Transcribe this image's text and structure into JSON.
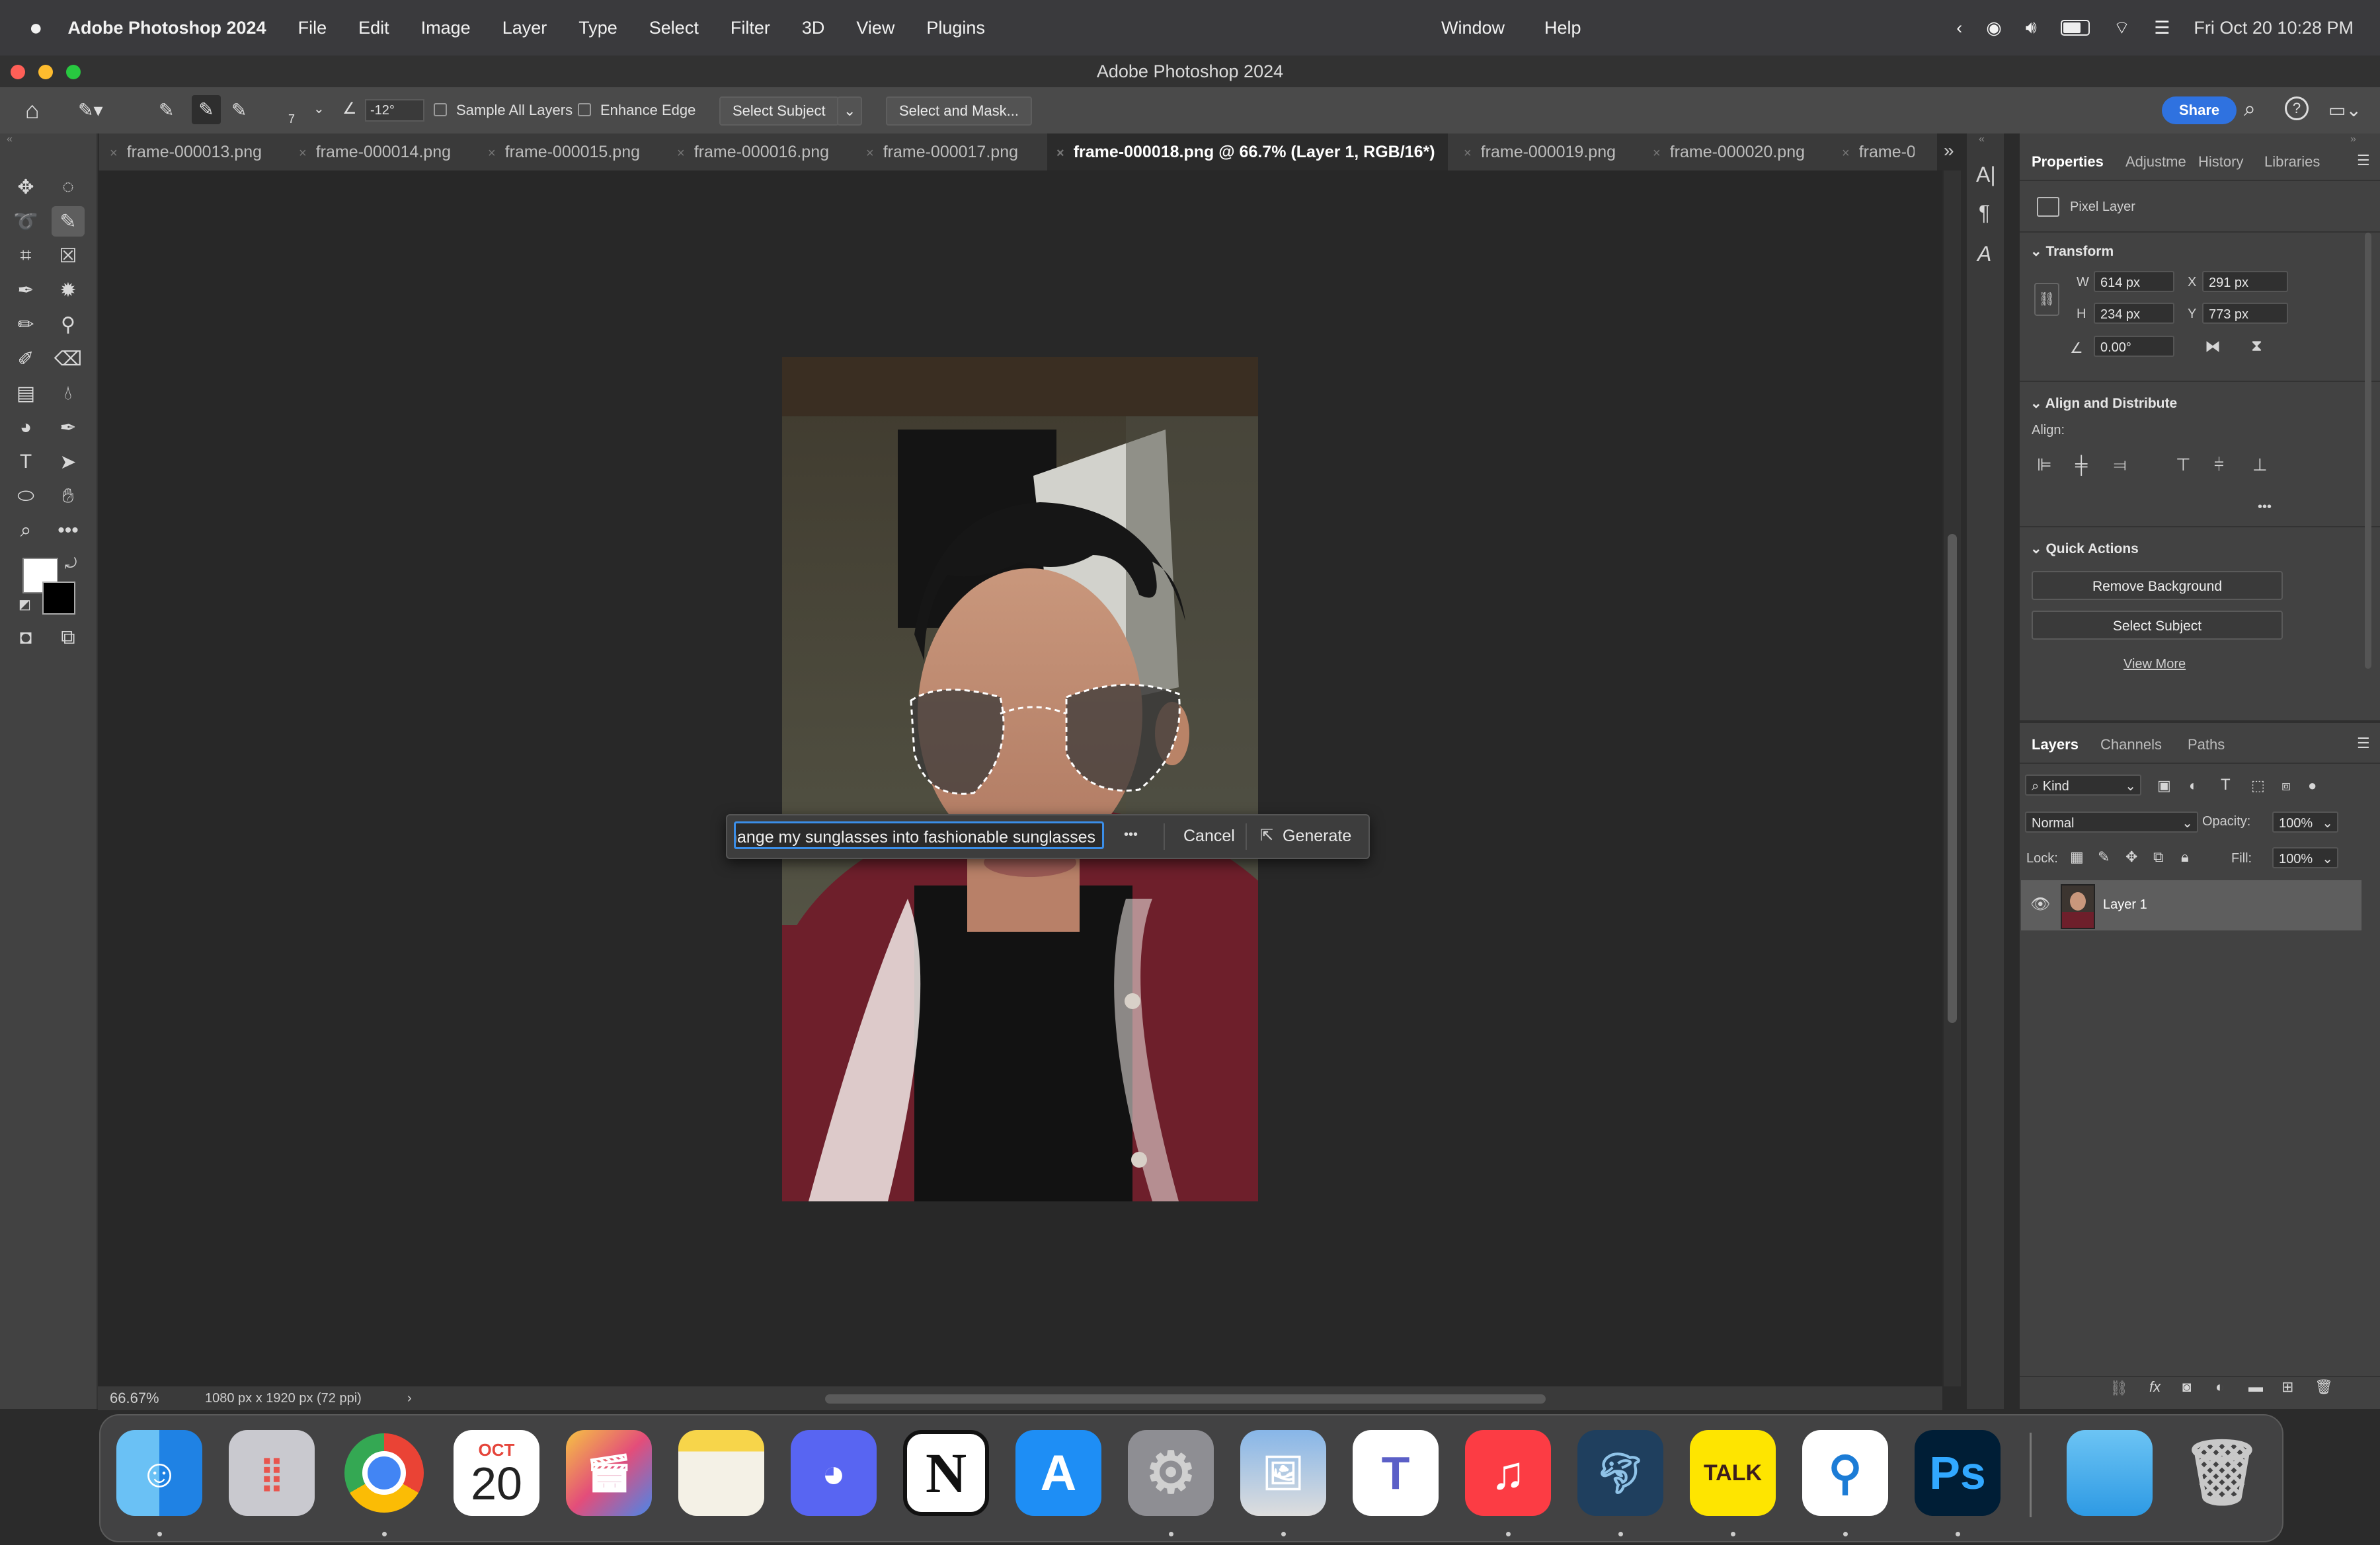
{
  "menubar": {
    "app_name": "Adobe Photoshop 2024",
    "items": [
      "File",
      "Edit",
      "Image",
      "Layer",
      "Type",
      "Select",
      "Filter",
      "3D",
      "View",
      "Plugins"
    ],
    "center_items": [
      "Window",
      "Help"
    ],
    "datetime": "Fri Oct 20  10:28 PM"
  },
  "window": {
    "title": "Adobe Photoshop 2024"
  },
  "options": {
    "brush_size": "7",
    "angle": "-12°",
    "sample_all_layers": "Sample All Layers",
    "enhance_edge": "Enhance Edge",
    "select_subject": "Select Subject",
    "select_and_mask": "Select and Mask...",
    "share": "Share"
  },
  "tabs": [
    "frame-000013.png",
    "frame-000014.png",
    "frame-000015.png",
    "frame-000016.png",
    "frame-000017.png",
    "frame-000018.png @ 66.7% (Layer 1, RGB/16*)",
    "frame-000019.png",
    "frame-000020.png",
    "frame-0"
  ],
  "generative_fill": {
    "prompt_value": "change my sunglasses into fashionable sunglasses",
    "more": "•••",
    "cancel": "Cancel",
    "generate": "Generate"
  },
  "status": {
    "zoom": "66.67%",
    "doc_info": "1080 px x 1920 px (72 ppi)",
    "arrow": "›"
  },
  "properties": {
    "tabs": [
      "Properties",
      "Adjustme",
      "History",
      "Libraries"
    ],
    "layer_type": "Pixel Layer",
    "transform": {
      "title": "Transform",
      "w_label": "W",
      "w": "614 px",
      "h_label": "H",
      "h": "234 px",
      "x_label": "X",
      "x": "291 px",
      "y_label": "Y",
      "y": "773 px",
      "angle": "0.00°"
    },
    "align": {
      "title": "Align and Distribute",
      "label": "Align:",
      "more": "•••"
    },
    "quick_actions": {
      "title": "Quick Actions",
      "remove_bg": "Remove Background",
      "select_subject": "Select Subject",
      "view_more": "View More"
    }
  },
  "layers": {
    "tabs": [
      "Layers",
      "Channels",
      "Paths"
    ],
    "filter": "Kind",
    "blend_mode": "Normal",
    "opacity_label": "Opacity:",
    "opacity": "100%",
    "lock_label": "Lock:",
    "fill_label": "Fill:",
    "fill": "100%",
    "layer_name": "Layer 1"
  },
  "dock": {
    "calendar_month": "OCT",
    "calendar_day": "20",
    "kakao": "TALK",
    "ps": "Ps",
    "notion": "N"
  }
}
